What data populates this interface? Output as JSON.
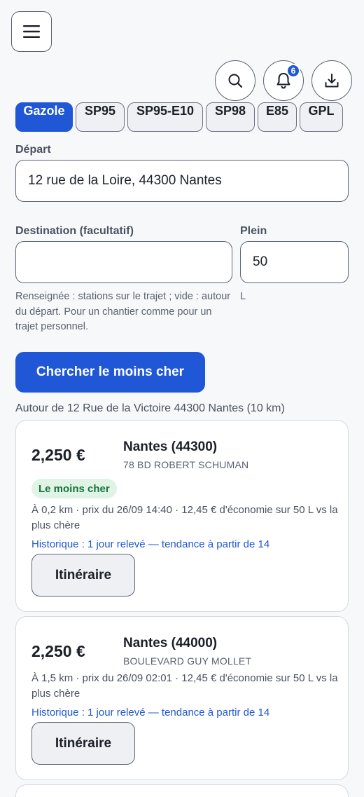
{
  "header": {
    "menu_icon": "hamburger-menu-icon",
    "search_icon": "search-icon",
    "notification_icon": "bell-icon",
    "notification_count": "6",
    "download_icon": "download-icon"
  },
  "fuel_types": [
    {
      "label": "Gazole",
      "active": true
    },
    {
      "label": "SP95",
      "active": false
    },
    {
      "label": "SP95-E10",
      "active": false
    },
    {
      "label": "SP98",
      "active": false
    },
    {
      "label": "E85",
      "active": false
    },
    {
      "label": "GPL",
      "active": false
    }
  ],
  "form": {
    "departure_label": "Départ",
    "departure_value": "12 rue de la Loire, 44300 Nantes",
    "destination_label": "Destination (facultatif)",
    "destination_value": "",
    "tank_label": "Plein",
    "tank_value": "50",
    "tank_unit": "L",
    "destination_help": "Renseignée : stations sur le trajet ; vide : autour du départ. Pour un chantier comme pour un trajet personnel.",
    "search_button": "Chercher le moins cher"
  },
  "results": {
    "area_text": "Autour de 12 Rue de la Victoire 44300 Nantes (10 km)",
    "stations": [
      {
        "price": "2,250 €",
        "city": "Nantes (44300)",
        "address": "78 BD ROBERT SCHUMAN",
        "badge": "Le moins cher",
        "detail": "À 0,2 km · prix du 26/09 14:40 · 12,45 € d'économie sur 50 L vs la plus chère",
        "history": "Historique : 1 jour relevé — tendance à partir de 14",
        "route_button": "Itinéraire"
      },
      {
        "price": "2,250 €",
        "city": "Nantes (44000)",
        "address": "BOULEVARD GUY MOLLET",
        "badge": "",
        "detail": "À 1,5 km · prix du 26/09 02:01 · 12,45 € d'économie sur 50 L vs la plus chère",
        "history": "Historique : 1 jour relevé — tendance à partir de 14",
        "route_button": "Itinéraire"
      }
    ]
  },
  "colors": {
    "accent": "#1f57d6",
    "badge_green_bg": "#e0f4e6",
    "badge_green_text": "#17733b"
  }
}
